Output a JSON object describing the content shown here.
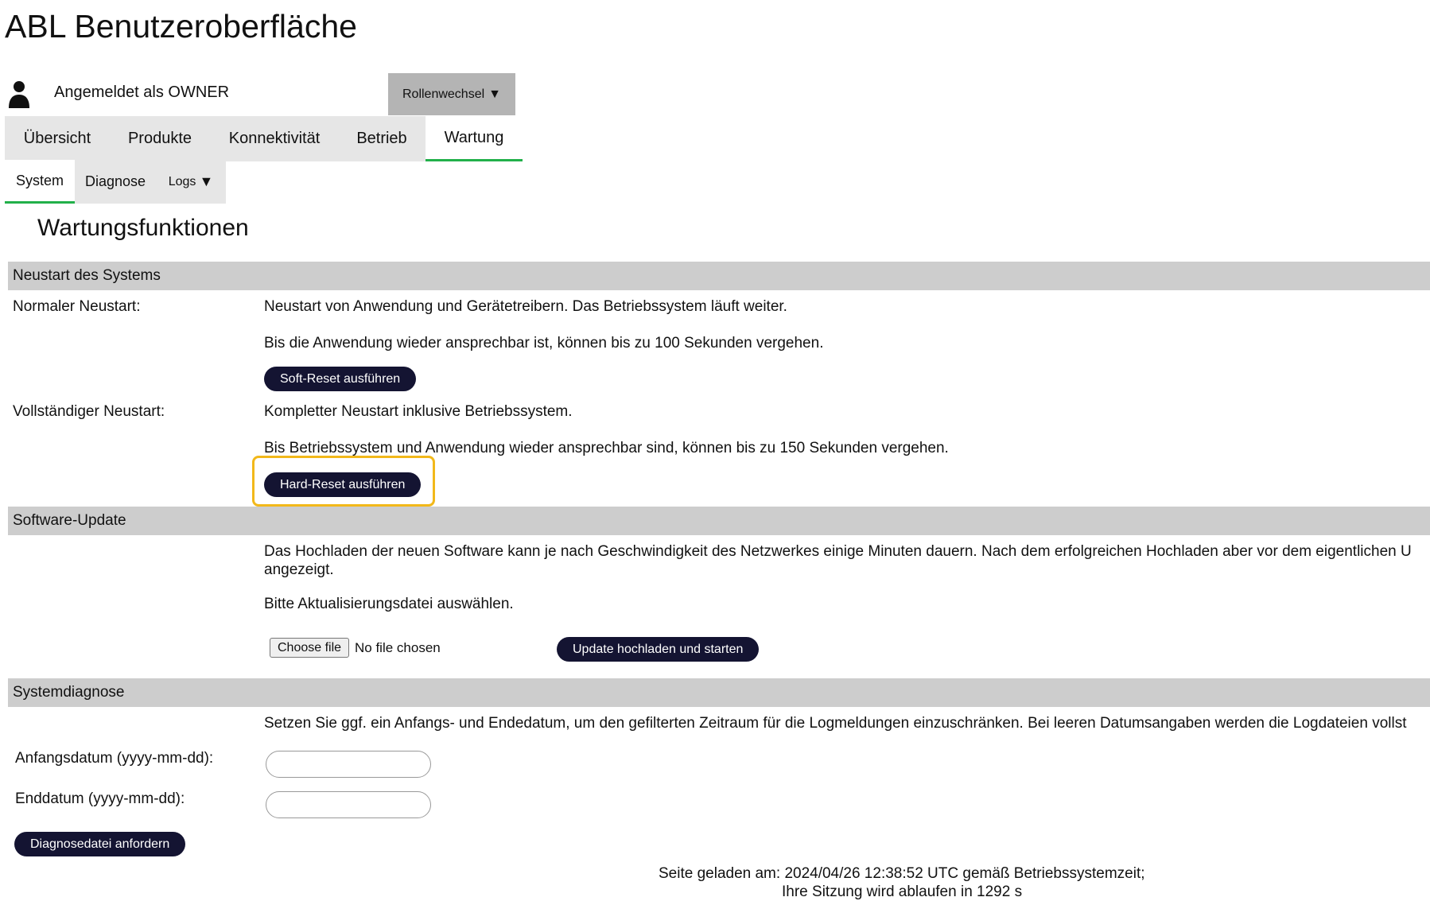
{
  "app": {
    "title": "ABL Benutzeroberfläche"
  },
  "user": {
    "label": "Angemeldet als OWNER",
    "icon": "user-icon"
  },
  "role_switch": {
    "label": "Rollenwechsel",
    "arrow": "▼"
  },
  "nav": {
    "tabs": [
      {
        "label": "Übersicht",
        "active": false
      },
      {
        "label": "Produkte",
        "active": false
      },
      {
        "label": "Konnektivität",
        "active": false
      },
      {
        "label": "Betrieb",
        "active": false
      },
      {
        "label": "Wartung",
        "active": true
      }
    ],
    "subtabs": [
      {
        "label": "System",
        "active": true
      },
      {
        "label": "Diagnose",
        "active": false
      },
      {
        "label": "Logs",
        "arrow": "▼",
        "active": false
      }
    ]
  },
  "page": {
    "title": "Wartungsfunktionen"
  },
  "restart": {
    "header": "Neustart des Systems",
    "normal": {
      "label": "Normaler Neustart:",
      "line1": "Neustart von Anwendung und Gerätetreibern. Das Betriebssystem läuft weiter.",
      "line2": "Bis die Anwendung wieder ansprechbar ist, können bis zu 100 Sekunden vergehen.",
      "button": "Soft-Reset ausführen"
    },
    "full": {
      "label": "Vollständiger Neustart:",
      "line1": "Kompletter Neustart inklusive Betriebssystem.",
      "line2": "Bis Betriebssystem und Anwendung wieder ansprechbar sind, können bis zu 150 Sekunden vergehen.",
      "button": "Hard-Reset ausführen"
    }
  },
  "update": {
    "header": "Software-Update",
    "line1": "Das Hochladen der neuen Software kann je nach Geschwindigkeit des Netzwerkes einige Minuten dauern. Nach dem erfolgreichen Hochladen aber vor dem eigentlichen U",
    "line1b": "angezeigt.",
    "line2": "Bitte Aktualisierungsdatei auswählen.",
    "file_button": "Choose file",
    "file_status": "No file chosen",
    "upload_button": "Update hochladen und starten"
  },
  "diagnosis": {
    "header": "Systemdiagnose",
    "text": "Setzen Sie ggf. ein Anfangs- und Endedatum, um den gefilterten Zeitraum für die Logmeldungen einzuschränken. Bei leeren Datumsangaben werden die Logdateien vollst",
    "start_label": "Anfangsdatum (yyyy-mm-dd):",
    "start_value": "",
    "end_label": "Enddatum (yyyy-mm-dd):",
    "end_value": "",
    "button": "Diagnosedatei anfordern"
  },
  "footer": {
    "line1": "Seite geladen am: 2024/04/26 12:38:52 UTC gemäß Betriebssystemzeit;",
    "line2": "Ihre Sitzung wird ablaufen in 1292 s"
  },
  "colors": {
    "accent": "#22b04a",
    "button_bg": "#141432",
    "section_bg": "#cdcdcd",
    "nav_bg": "#e6e6e6",
    "highlight": "#f2b81a"
  }
}
